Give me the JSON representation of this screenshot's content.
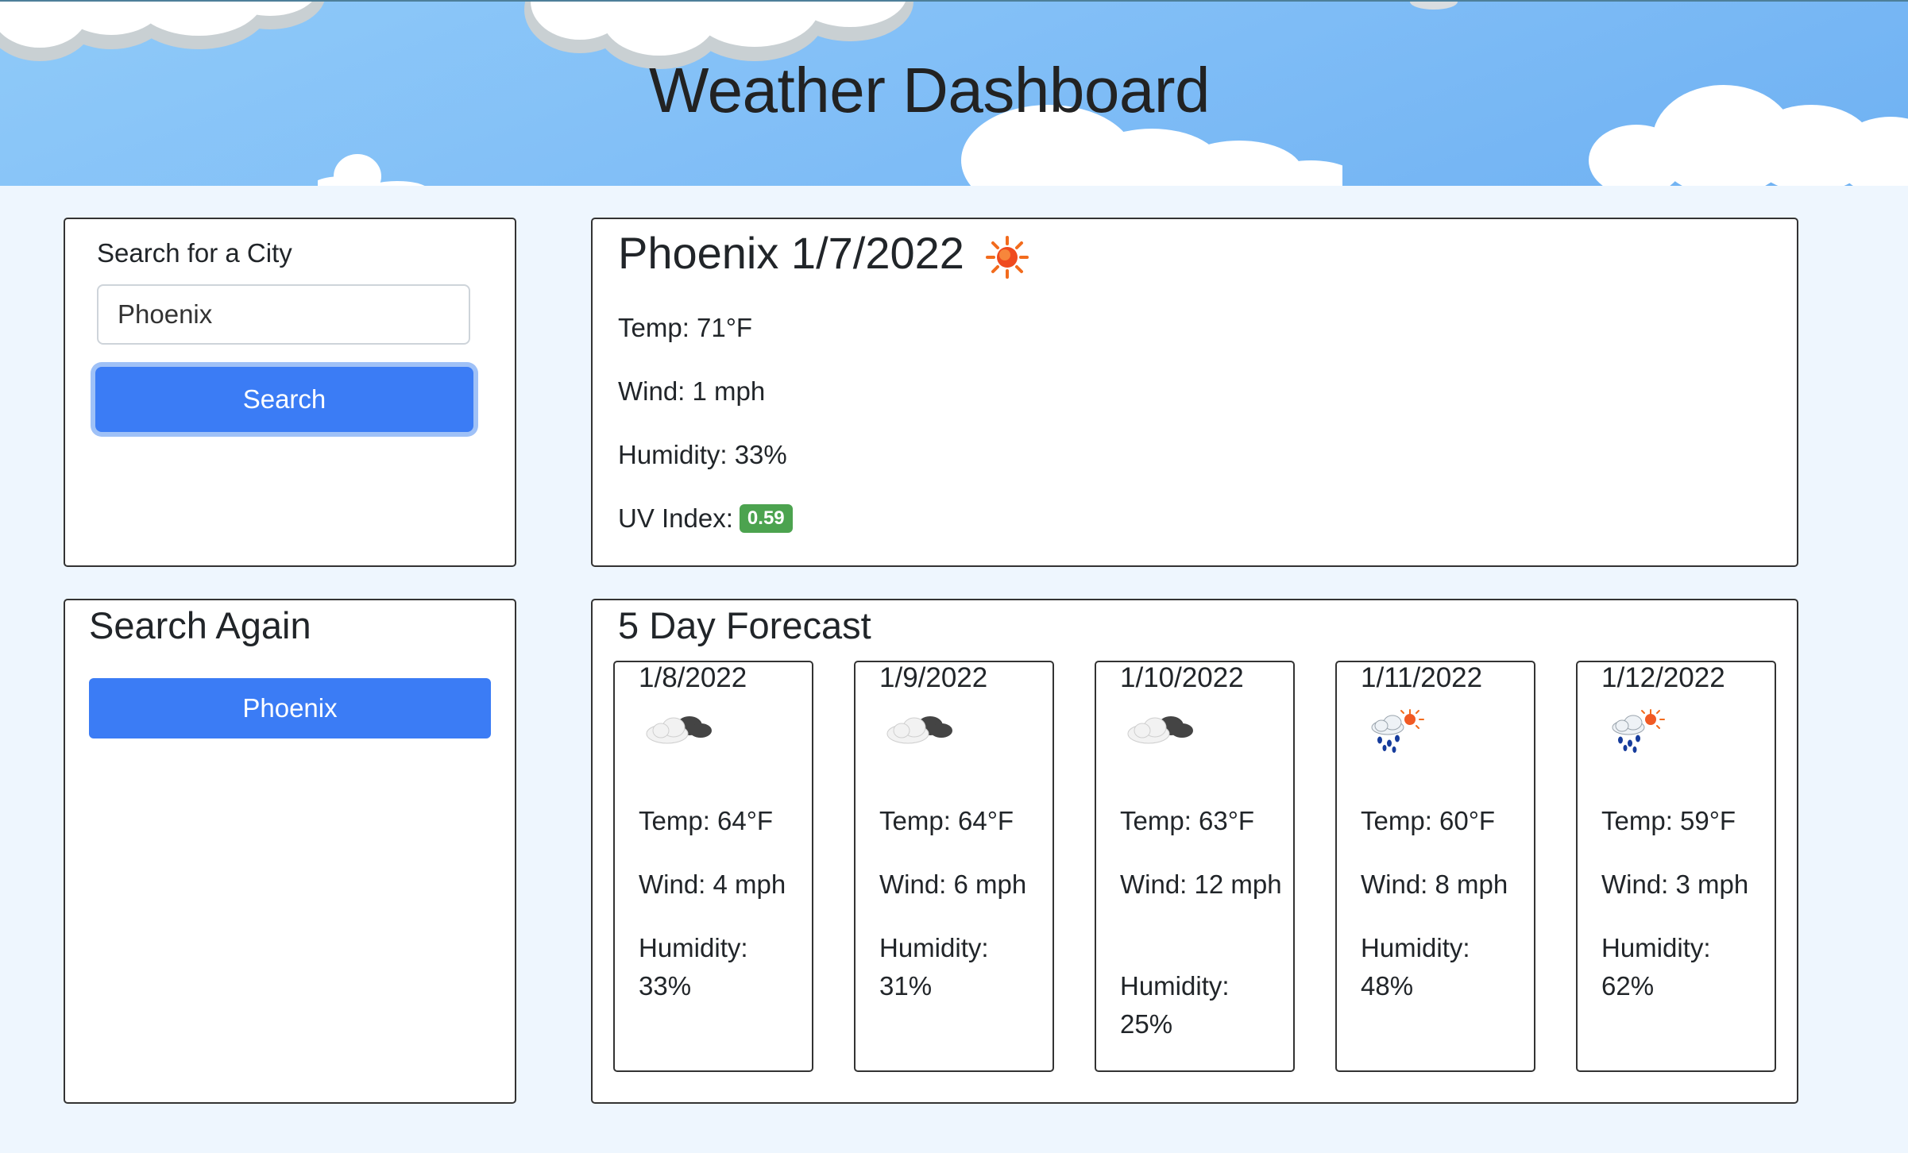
{
  "header": {
    "title": "Weather Dashboard"
  },
  "search": {
    "label": "Search for a City",
    "value": "Phoenix",
    "button_label": "Search"
  },
  "history": {
    "title": "Search Again",
    "items": [
      "Phoenix"
    ]
  },
  "current": {
    "title": "Phoenix 1/7/2022",
    "icon": "sun-icon",
    "temp": "Temp: 71°F",
    "wind": "Wind: 1 mph",
    "humidity": "Humidity: 33%",
    "uv_label": "UV Index:",
    "uv_value": "0.59",
    "uv_color": "#4ca34f"
  },
  "forecast": {
    "title": "5 Day Forecast",
    "days": [
      {
        "date": "1/8/2022",
        "icon": "cloudy-icon",
        "temp": "Temp: 64°F",
        "wind": "Wind: 4 mph",
        "humidity": "Humidity: 33%"
      },
      {
        "date": "1/9/2022",
        "icon": "cloudy-icon",
        "temp": "Temp: 64°F",
        "wind": "Wind: 6 mph",
        "humidity": "Humidity: 31%"
      },
      {
        "date": "1/10/2022",
        "icon": "cloudy-icon",
        "temp": "Temp: 63°F",
        "wind": "Wind: 12 mph",
        "humidity": "Humidity: 25%"
      },
      {
        "date": "1/11/2022",
        "icon": "rain-sun-icon",
        "temp": "Temp: 60°F",
        "wind": "Wind: 8 mph",
        "humidity": "Humidity: 48%"
      },
      {
        "date": "1/12/2022",
        "icon": "rain-sun-icon",
        "temp": "Temp: 59°F",
        "wind": "Wind: 3 mph",
        "humidity": "Humidity: 62%"
      }
    ]
  },
  "colors": {
    "accent": "#3b7cf5",
    "background": "#eef6fe",
    "header_sky": "#82bff7"
  }
}
